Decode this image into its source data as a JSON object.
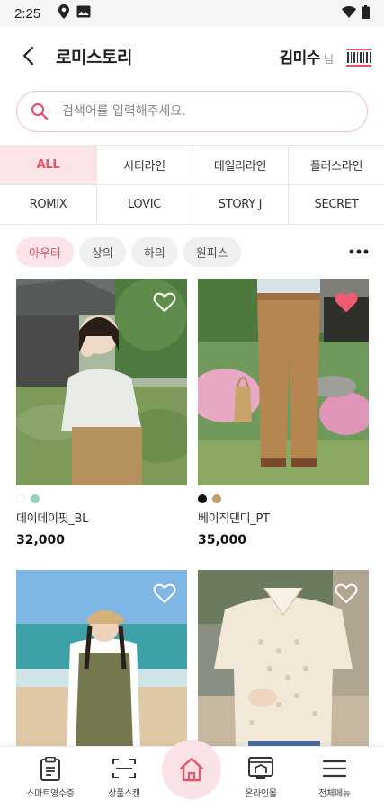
{
  "status_bar": {
    "time": "2:25"
  },
  "header": {
    "title": "로미스토리",
    "user_name": "김미수",
    "user_suffix": "님"
  },
  "search": {
    "placeholder": "검색어를 입력해주세요."
  },
  "brands": [
    {
      "label": "ALL",
      "active": true
    },
    {
      "label": "시티라인",
      "active": false
    },
    {
      "label": "데일리라인",
      "active": false
    },
    {
      "label": "플러스라인",
      "active": false
    },
    {
      "label": "ROMIX",
      "active": false
    },
    {
      "label": "LOVIC",
      "active": false
    },
    {
      "label": "STORY J",
      "active": false
    },
    {
      "label": "SECRET",
      "active": false
    }
  ],
  "categories": [
    {
      "label": "아우터",
      "active": true
    },
    {
      "label": "상의",
      "active": false
    },
    {
      "label": "하의",
      "active": false
    },
    {
      "label": "원피스",
      "active": false
    }
  ],
  "products": [
    {
      "name": "데이데이핏_BL",
      "price": "32,000",
      "liked": false,
      "swatches": [
        "#ffffff",
        "#8fd3c0"
      ]
    },
    {
      "name": "베이직댄디_PT",
      "price": "35,000",
      "liked": true,
      "swatches": [
        "#111111",
        "#c49a6c"
      ]
    },
    {
      "name": "",
      "price": "",
      "liked": false,
      "swatches": []
    },
    {
      "name": "",
      "price": "",
      "liked": false,
      "swatches": []
    }
  ],
  "bottom_nav": [
    {
      "label": "스마트영수증",
      "icon": "receipt-icon"
    },
    {
      "label": "상품스캔",
      "icon": "scan-icon"
    },
    {
      "label": "",
      "icon": "home-icon"
    },
    {
      "label": "온라인몰",
      "icon": "shop-icon"
    },
    {
      "label": "전체메뉴",
      "icon": "menu-icon"
    }
  ],
  "colors": {
    "accent": "#e2566e",
    "accent_light": "#fbe4e8",
    "heart_active": "#f05a73"
  }
}
